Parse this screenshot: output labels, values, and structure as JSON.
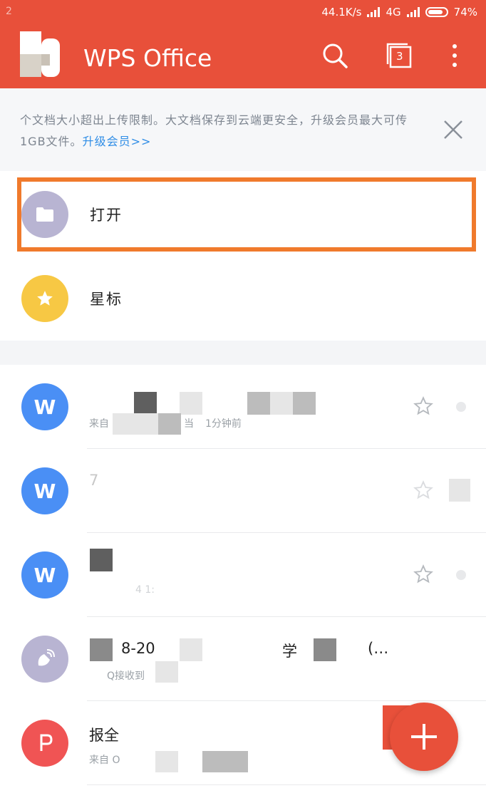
{
  "status_bar": {
    "left_text": "2",
    "network_speed": "44.1K/s",
    "network_type": "4G",
    "battery": "74%"
  },
  "app_bar": {
    "title": "WPS Office",
    "tab_count": "3"
  },
  "banner": {
    "text": "个文档大小超出上传限制。大文档保存到云端更安全，升级会员最大可传1GB文件。",
    "link": "升级会员>>"
  },
  "quick_actions": [
    {
      "label": "打开",
      "icon": "folder-icon"
    },
    {
      "label": "星标",
      "icon": "star-icon"
    }
  ],
  "documents": [
    {
      "title": "",
      "subtitle": "来自",
      "subtitle2": "当",
      "subtitle3": "1分钟前"
    },
    {
      "title": "7",
      "subtitle": ""
    },
    {
      "title": "",
      "subtitle": "4  1:"
    },
    {
      "title": "8-20",
      "title2": "学",
      "title3": "(…",
      "subtitle": "Q接收到"
    },
    {
      "title": "报全",
      "subtitle": "来自 O"
    }
  ],
  "colors": {
    "brand": "#e8503a",
    "highlight": "#f07a2c",
    "wps_blue": "#4a8ff5",
    "folder_purple": "#b8b4d2",
    "star_yellow": "#f7c844",
    "pdf_red": "#f05454",
    "link_blue": "#2f8de6"
  },
  "fab": {
    "icon": "plus-icon"
  }
}
